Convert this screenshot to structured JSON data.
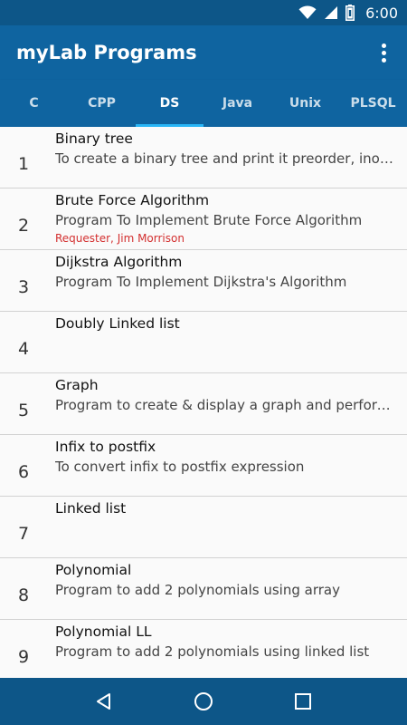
{
  "status_bar": {
    "time": "6:00",
    "icons": [
      "wifi-icon",
      "cell-signal-icon",
      "battery-icon"
    ]
  },
  "app_bar": {
    "title": "myLab Programs",
    "menu_icon": "more-vert-icon"
  },
  "tabs": [
    {
      "label": "C",
      "active": false
    },
    {
      "label": "CPP",
      "active": false
    },
    {
      "label": "DS",
      "active": true
    },
    {
      "label": "Java",
      "active": false
    },
    {
      "label": "Unix",
      "active": false
    },
    {
      "label": "PLSQL",
      "active": false
    }
  ],
  "programs": [
    {
      "num": "1",
      "title": "Binary tree",
      "desc": "To create a binary tree and print it preorder, inorder and postorder",
      "requester": ""
    },
    {
      "num": "2",
      "title": "Brute Force Algorithm",
      "desc": "Program To Implement Brute Force Algorithm",
      "requester": "Requester, Jim Morrison"
    },
    {
      "num": "3",
      "title": "Dijkstra Algorithm",
      "desc": "Program To Implement Dijkstra's Algorithm",
      "requester": ""
    },
    {
      "num": "4",
      "title": "Doubly Linked list",
      "desc": "",
      "requester": ""
    },
    {
      "num": "5",
      "title": "Graph",
      "desc": "Program to create & display a graph and perform BFS and DFS",
      "requester": ""
    },
    {
      "num": "6",
      "title": "Infix to postfix",
      "desc": "To convert infix to postfix expression",
      "requester": ""
    },
    {
      "num": "7",
      "title": "Linked list",
      "desc": "",
      "requester": ""
    },
    {
      "num": "8",
      "title": "Polynomial",
      "desc": "Program to add 2 polynomials using array",
      "requester": ""
    },
    {
      "num": "9",
      "title": "Polynomial LL",
      "desc": "Program to add 2 polynomials using linked list",
      "requester": ""
    }
  ],
  "nav_bar": {
    "icons": [
      "back-icon",
      "home-icon",
      "recents-icon"
    ]
  },
  "colors": {
    "primary": "#0f64a0",
    "primary_dark": "#0d5688",
    "tab_indicator": "#29b6f6",
    "requester": "#d32f2f"
  }
}
